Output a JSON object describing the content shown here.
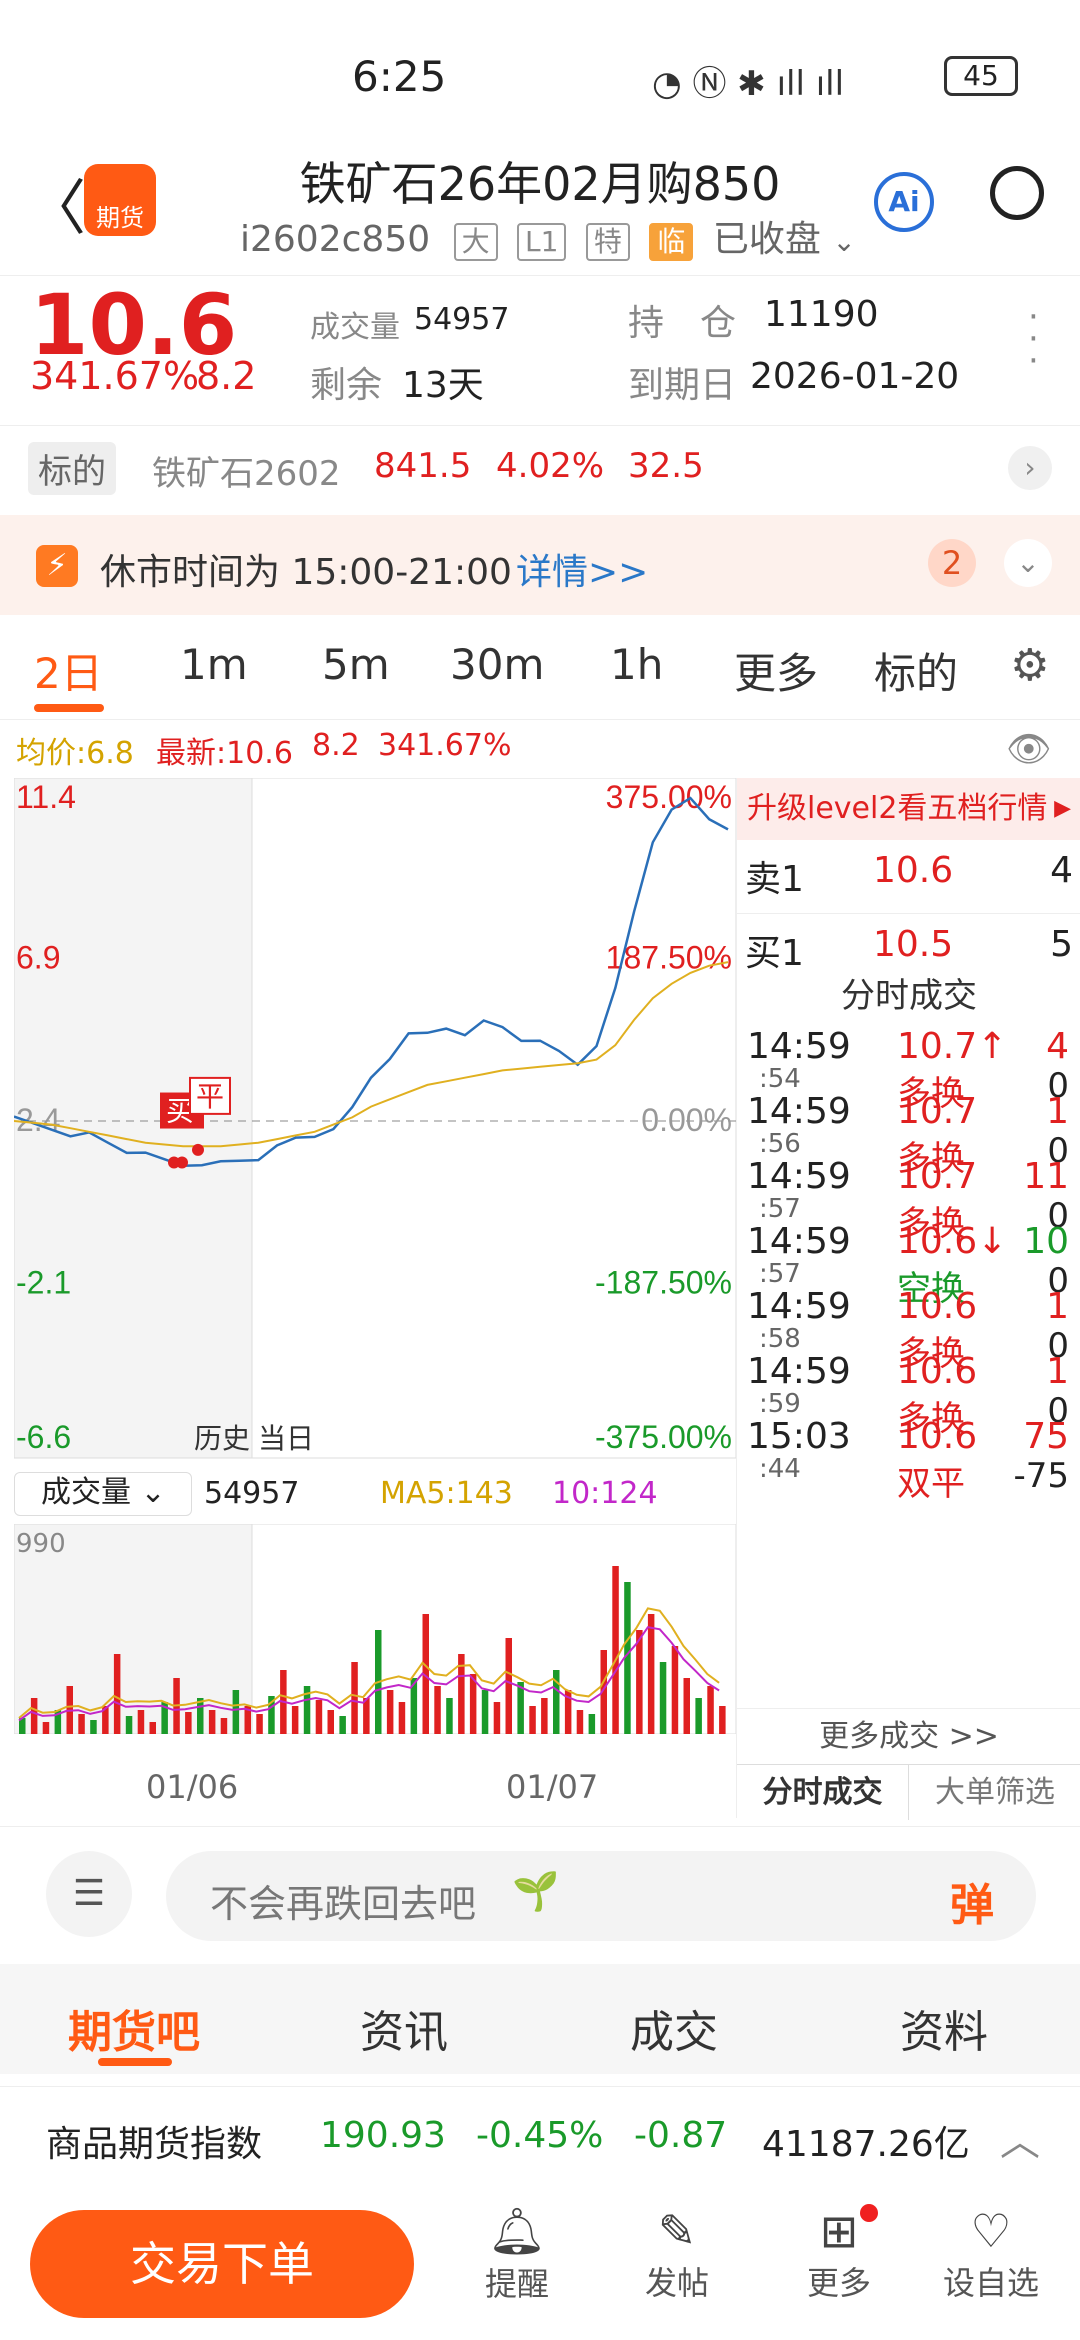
{
  "status_bar": {
    "time": "6:25",
    "battery": "45"
  },
  "header": {
    "title": "铁矿石26年02月购850",
    "code": "i2602c850",
    "tags": [
      "大",
      "L1",
      "特"
    ],
    "tag_hot": "临",
    "market_status": "已收盘"
  },
  "quote": {
    "price": "10.6",
    "change_pct": "341.67%",
    "change": "8.2",
    "volume_label": "成交量",
    "volume": "54957",
    "remain_label": "剩余",
    "remain": "13天",
    "hold_label": "持　仓",
    "hold": "11190",
    "expire_label": "到期日",
    "expire": "2026-01-20"
  },
  "underlying": {
    "label": "标的",
    "name": "铁矿石2602",
    "price": "841.5",
    "pct": "4.02%",
    "chg": "32.5"
  },
  "notice": {
    "text": "休市时间为 15:00-21:00",
    "link": "详情>>",
    "badge": "2"
  },
  "period_tabs": [
    "2日",
    "1m",
    "5m",
    "30m",
    "1h",
    "更多",
    "标的"
  ],
  "chart_info": {
    "avg": "均价:6.8",
    "latest": "最新:10.6",
    "chg": "8.2",
    "pct": "341.67%"
  },
  "chart_data": {
    "type": "line",
    "y_left_ticks": [
      "11.4",
      "6.9",
      "2.4",
      "-2.1",
      "-6.6"
    ],
    "y_right_ticks": [
      "375.00%",
      "187.50%",
      "0.00%",
      "-187.50%",
      "-375.00%"
    ],
    "ylim": [
      -6.6,
      11.4
    ],
    "x_labels": [
      "01/06",
      "01/07"
    ],
    "series": [
      {
        "name": "",
        "color": "#2a6fb8",
        "values": [
          2.4,
          2.3,
          2.2,
          2.1,
          2.0,
          1.8,
          1.6,
          1.4,
          1.3,
          1.2,
          1.3,
          1.2,
          1.3,
          1.4,
          1.6,
          1.9,
          2.0,
          2.3,
          2.7,
          3.6,
          4.2,
          4.7,
          4.8,
          5.0,
          4.9,
          5.1,
          5.0,
          4.7,
          4.5,
          4.3,
          4.0,
          4.6,
          6.0,
          8.2,
          10.2,
          10.9,
          11.3,
          10.8,
          10.6
        ]
      },
      {
        "name": "",
        "color": "#e0b020",
        "values": [
          2.4,
          2.35,
          2.3,
          2.2,
          2.1,
          2.0,
          1.9,
          1.8,
          1.75,
          1.7,
          1.7,
          1.7,
          1.75,
          1.8,
          1.9,
          2.0,
          2.1,
          2.3,
          2.5,
          2.8,
          3.0,
          3.2,
          3.4,
          3.5,
          3.6,
          3.7,
          3.8,
          3.85,
          3.9,
          3.95,
          4.0,
          4.1,
          4.5,
          5.2,
          5.8,
          6.2,
          6.5,
          6.7,
          6.8
        ]
      }
    ],
    "markers": [
      "买",
      "平"
    ],
    "history_label": "历史",
    "today_label": "当日"
  },
  "volume_bar": {
    "label": "成交量",
    "value": "54957",
    "ma5": "MA5:143",
    "ma10": "10:124",
    "ymax": "990"
  },
  "volume_data": [
    40,
    90,
    30,
    60,
    120,
    50,
    35,
    70,
    200,
    45,
    60,
    30,
    80,
    140,
    55,
    90,
    60,
    40,
    110,
    70,
    50,
    95,
    160,
    70,
    120,
    85,
    60,
    45,
    180,
    90,
    260,
    110,
    80,
    140,
    300,
    120,
    90,
    200,
    150,
    110,
    80,
    240,
    130,
    70,
    90,
    160,
    110,
    60,
    50,
    210,
    420,
    380,
    260,
    300,
    180,
    220,
    140,
    90,
    120,
    70
  ],
  "orderbook": {
    "promo": "升级level2看五档行情",
    "sell_label": "卖1",
    "sell_price": "10.6",
    "sell_qty": "4",
    "buy_label": "买1",
    "buy_price": "10.5",
    "buy_qty": "5",
    "title": "分时成交"
  },
  "ticks": [
    {
      "time": "14:59",
      "sec": ":54",
      "price": "10.7↑",
      "qty": "4",
      "kind": "多换",
      "n": "0",
      "pc": "red",
      "qc": "red",
      "kc": "red"
    },
    {
      "time": "14:59",
      "sec": ":56",
      "price": "10.7",
      "qty": "1",
      "kind": "多换",
      "n": "0",
      "pc": "red",
      "qc": "red",
      "kc": "red"
    },
    {
      "time": "14:59",
      "sec": ":57",
      "price": "10.7",
      "qty": "11",
      "kind": "多换",
      "n": "0",
      "pc": "red",
      "qc": "red",
      "kc": "red"
    },
    {
      "time": "14:59",
      "sec": ":57",
      "price": "10.6↓",
      "qty": "10",
      "kind": "空换",
      "n": "0",
      "pc": "red",
      "qc": "green",
      "kc": "green"
    },
    {
      "time": "14:59",
      "sec": ":58",
      "price": "10.6",
      "qty": "1",
      "kind": "多换",
      "n": "0",
      "pc": "red",
      "qc": "red",
      "kc": "red"
    },
    {
      "time": "14:59",
      "sec": ":59",
      "price": "10.6",
      "qty": "1",
      "kind": "多换",
      "n": "0",
      "pc": "red",
      "qc": "red",
      "kc": "red"
    },
    {
      "time": "15:03",
      "sec": ":44",
      "price": "10.6",
      "qty": "75",
      "kind": "双平",
      "n": "-75",
      "pc": "red",
      "qc": "red",
      "kc": "red"
    }
  ],
  "more_trades": "更多成交 >>",
  "side_tabs": [
    "分时成交",
    "大单筛选"
  ],
  "comment": {
    "placeholder": "不会再跌回去吧",
    "danmu": "弹"
  },
  "bottom_tabs": [
    "期货吧",
    "资讯",
    "成交",
    "资料"
  ],
  "index_bar": {
    "name": "商品期货指数",
    "value": "190.93",
    "pct": "-0.45%",
    "chg": "-0.87",
    "amount": "41187.26亿"
  },
  "nav": {
    "trade": "交易下单",
    "items": [
      "提醒",
      "发帖",
      "更多",
      "设自选"
    ]
  }
}
